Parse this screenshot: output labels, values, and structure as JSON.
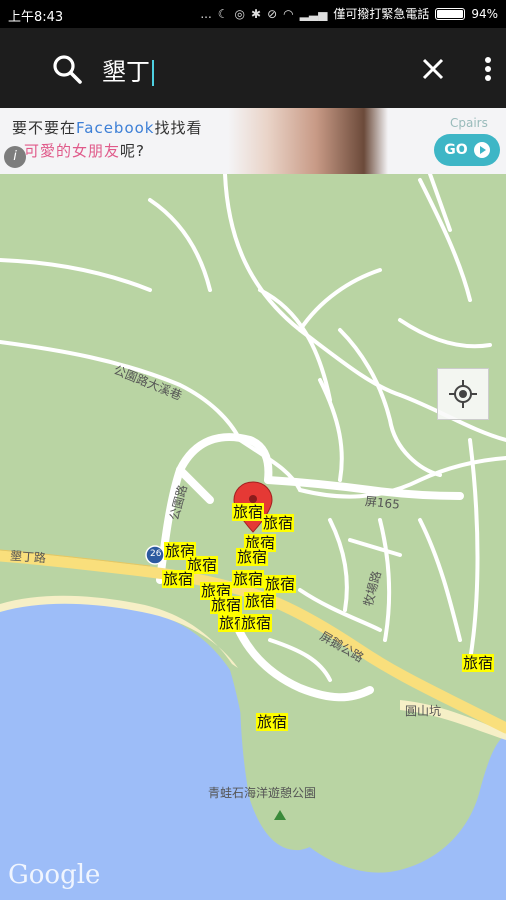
{
  "status_bar": {
    "time": "上午8:43",
    "dots": "...",
    "carrier": "僅可撥打緊急電話",
    "battery": "94%",
    "battery_level": 0.94
  },
  "search": {
    "query": "墾丁",
    "search_icon": "search-icon",
    "clear_icon": "close-icon",
    "more_icon": "more-vert-icon"
  },
  "ad": {
    "line1_a": "要不要在",
    "line1_b": "Facebook",
    "line1_c": "找找看",
    "line2_a": "可愛的女朋友",
    "line2_b": "呢?",
    "brand": "Cpairs",
    "go_label": "GO",
    "info_label": "i"
  },
  "map": {
    "labels": {
      "road_park": "公園路大溪巷",
      "road_park2": "公園路",
      "road_kenting": "墾丁路",
      "road_165": "屏165",
      "road_muchang": "牧場路",
      "road_pingeh": "屏鵝公路",
      "place_yuanshan": "圓山坑",
      "place_park": "青蛙石海洋遊憩公園",
      "shield": "26"
    },
    "hotel_label": "旅宿",
    "attribution": "Google",
    "colors": {
      "land": "#b9d4a3",
      "water": "#9dbdf8",
      "road_major": "#f9df7c",
      "road_minor": "#ffffff",
      "marker": "#e53935",
      "hotel_bg": "#ffff00"
    }
  }
}
